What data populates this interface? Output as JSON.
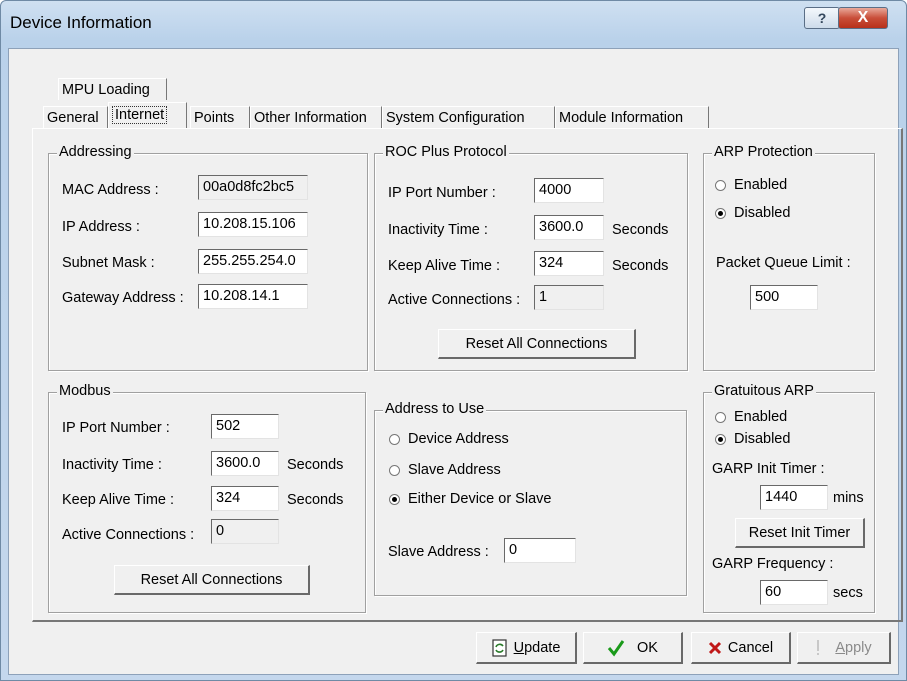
{
  "window": {
    "title": "Device Information",
    "help_glyph": "?",
    "close_glyph": "X"
  },
  "tabs": {
    "row_back": [
      "MPU Loading"
    ],
    "row_front": [
      "General",
      "Internet",
      "Points",
      "Other Information",
      "System Configuration",
      "Module Information"
    ],
    "active": "Internet"
  },
  "addressing": {
    "title": "Addressing",
    "mac_label": "MAC Address :",
    "mac_value": "00a0d8fc2bc5",
    "ip_label": "IP Address :",
    "ip_value": "10.208.15.106",
    "subnet_label": "Subnet Mask :",
    "subnet_value": "255.255.254.0",
    "gateway_label": "Gateway Address :",
    "gateway_value": "10.208.14.1"
  },
  "roc": {
    "title": "ROC Plus Protocol",
    "port_label": "IP Port Number :",
    "port_value": "4000",
    "inactivity_label": "Inactivity Time :",
    "inactivity_value": "3600.0",
    "inactivity_unit": "Seconds",
    "keepalive_label": "Keep Alive Time :",
    "keepalive_value": "324",
    "keepalive_unit": "Seconds",
    "active_label": "Active Connections :",
    "active_value": "1",
    "reset_label": "Reset All Connections"
  },
  "arp": {
    "title": "ARP Protection",
    "enabled_label": "Enabled",
    "disabled_label": "Disabled",
    "selected": "Disabled",
    "queue_label": "Packet Queue Limit :",
    "queue_value": "500"
  },
  "modbus": {
    "title": "Modbus",
    "port_label": "IP Port Number :",
    "port_value": "502",
    "inactivity_label": "Inactivity Time :",
    "inactivity_value": "3600.0",
    "inactivity_unit": "Seconds",
    "keepalive_label": "Keep Alive Time :",
    "keepalive_value": "324",
    "keepalive_unit": "Seconds",
    "active_label": "Active Connections :",
    "active_value": "0",
    "reset_label": "Reset All Connections"
  },
  "address_to_use": {
    "title": "Address to Use",
    "options": [
      "Device Address",
      "Slave Address",
      "Either Device or Slave"
    ],
    "selected": "Either Device or Slave",
    "slave_label": "Slave Address :",
    "slave_value": "0"
  },
  "garp": {
    "title": "Gratuitous ARP",
    "enabled_label": "Enabled",
    "disabled_label": "Disabled",
    "selected": "Disabled",
    "init_label": "GARP Init Timer :",
    "init_value": "1440",
    "init_unit": "mins",
    "reset_label": "Reset Init Timer",
    "freq_label": "GARP Frequency :",
    "freq_value": "60",
    "freq_unit": "secs"
  },
  "buttons": {
    "update_key": "U",
    "update_rest": "pdate",
    "ok": "OK",
    "cancel": "Cancel",
    "apply_key": "A",
    "apply_rest": "pply"
  },
  "icons": {
    "update": "refresh-icon",
    "ok": "checkmark-icon",
    "cancel": "x-icon",
    "apply": "exclamation-icon",
    "ok_color": "#1a9a1a",
    "cancel_color": "#c01818"
  }
}
